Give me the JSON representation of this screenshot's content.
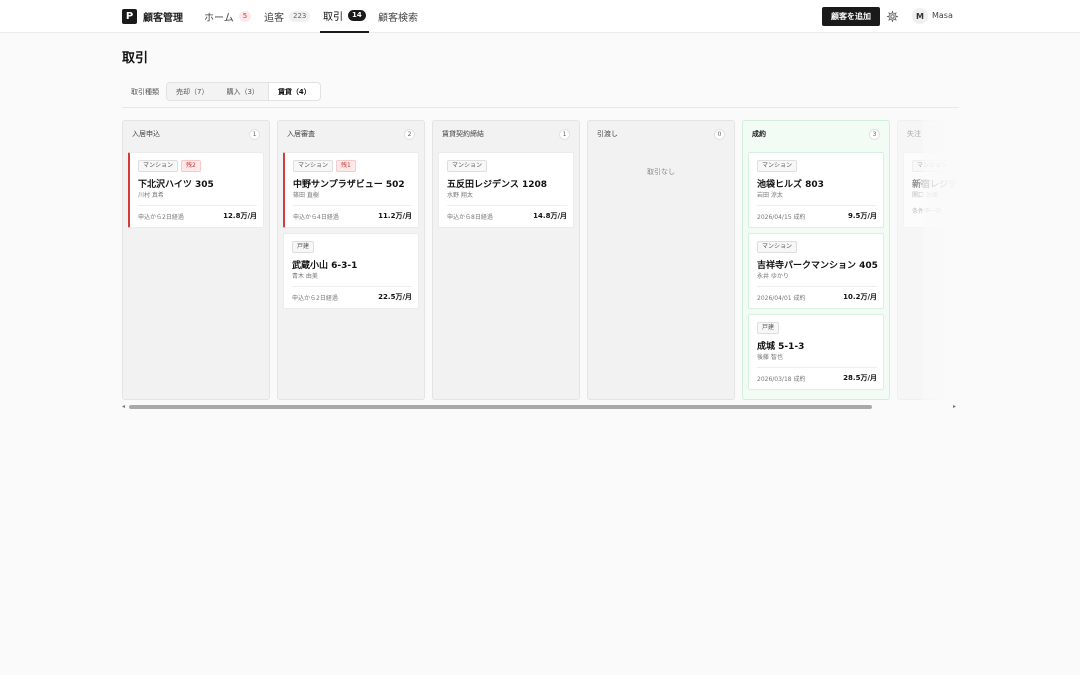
{
  "brand": {
    "logo": "P",
    "name": "顧客管理"
  },
  "nav": {
    "tabs": [
      {
        "label": "ホーム",
        "badge": "5"
      },
      {
        "label": "追客",
        "badge": "223"
      },
      {
        "label": "取引",
        "badge": "14"
      },
      {
        "label": "顧客検索"
      }
    ]
  },
  "header": {
    "add_button": "顧客を追加",
    "avatar_initial": "M",
    "username": "Masa"
  },
  "page": {
    "title": "取引"
  },
  "filter": {
    "label": "取引種類",
    "options": [
      "売却（7）",
      "購入（3）",
      "賃貸（4）"
    ],
    "selected": "賃貸（4）"
  },
  "columns": [
    {
      "title": "入居申込",
      "count": "1",
      "cards": [
        {
          "tag": "マンション",
          "alert": "残2",
          "title": "下北沢ハイツ 305",
          "name": "川村 真希",
          "meta": "申込から2日経過",
          "price": "12.8万/月"
        }
      ]
    },
    {
      "title": "入居審査",
      "count": "2",
      "cards": [
        {
          "tag": "マンション",
          "alert": "残1",
          "title": "中野サンプラザビュー 502",
          "name": "篠田 直樹",
          "meta": "申込から4日経過",
          "price": "11.2万/月"
        },
        {
          "tag": "戸建",
          "title": "武蔵小山 6-3-1",
          "name": "青木 由美",
          "meta": "申込から2日経過",
          "price": "22.5万/月"
        }
      ]
    },
    {
      "title": "賃貸契約締結",
      "count": "1",
      "cards": [
        {
          "tag": "マンション",
          "title": "五反田レジデンス 1208",
          "name": "水野 翔太",
          "meta": "申込から8日経過",
          "price": "14.8万/月"
        }
      ]
    },
    {
      "title": "引渡し",
      "count": "0",
      "empty": "取引なし"
    },
    {
      "title": "成約",
      "count": "3",
      "cards": [
        {
          "tag": "マンション",
          "title": "池袋ヒルズ 803",
          "name": "岩田 涼太",
          "meta": "2026/04/15 成約",
          "price": "9.5万/月"
        },
        {
          "tag": "マンション",
          "title": "吉祥寺パークマンション 405",
          "name": "永井 ゆかり",
          "meta": "2026/04/01 成約",
          "price": "10.2万/月"
        },
        {
          "tag": "戸建",
          "title": "成城 5-1-3",
          "name": "後藤 智也",
          "meta": "2026/03/18 成約",
          "price": "28.5万/月"
        }
      ]
    },
    {
      "title": "失注",
      "cards": [
        {
          "tag": "マンション",
          "title": "新宿レジデ",
          "name": "関口 沙織",
          "meta": "条件不一致"
        }
      ]
    }
  ],
  "scroll": {
    "left": "◂",
    "right": "▸"
  },
  "colors": {
    "accent": "#1a1a1a",
    "alert": "#d23b3b",
    "success_bg": "#f3fbf5"
  }
}
